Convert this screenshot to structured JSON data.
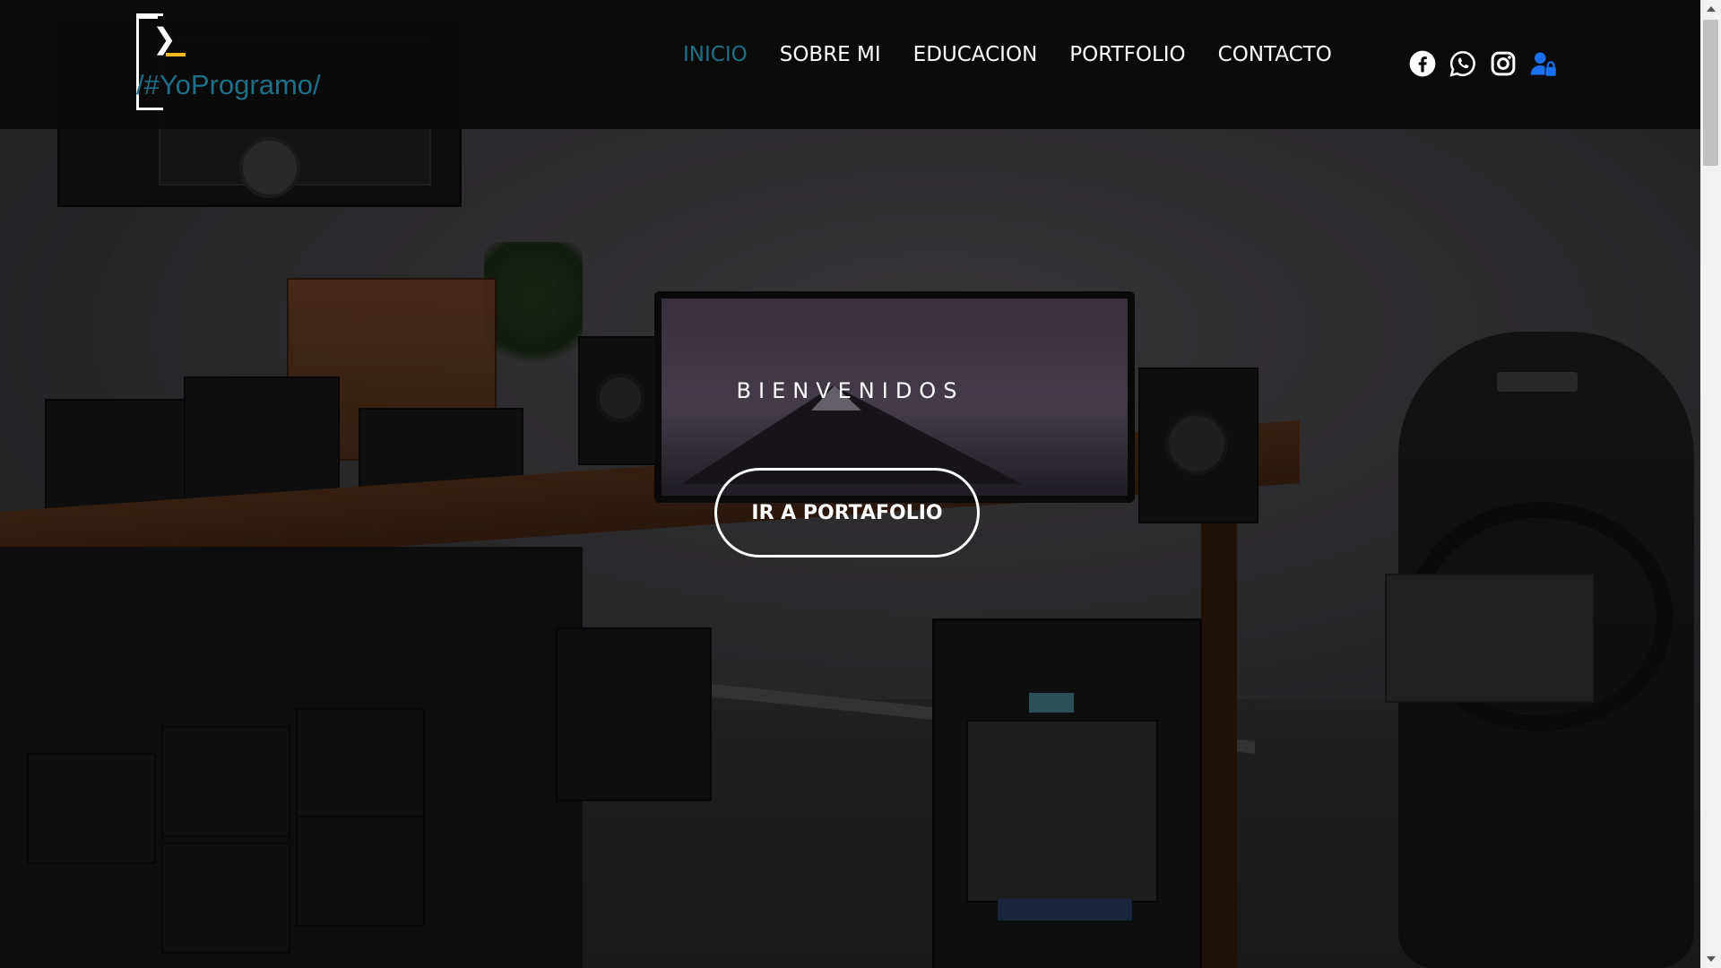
{
  "brand": {
    "text": "/#YoProgramo/",
    "chevron": "❯"
  },
  "nav": {
    "items": [
      {
        "label": "INICIO",
        "active": true
      },
      {
        "label": "SOBRE MI",
        "active": false
      },
      {
        "label": "EDUCACION",
        "active": false
      },
      {
        "label": "PORTFOLIO",
        "active": false
      },
      {
        "label": "CONTACTO",
        "active": false
      }
    ]
  },
  "socials": [
    {
      "icon": "facebook-icon"
    },
    {
      "icon": "whatsapp-icon"
    },
    {
      "icon": "instagram-icon"
    },
    {
      "icon": "user-lock-icon"
    }
  ],
  "hero": {
    "welcome": "BIENVENIDOS",
    "cta_label": "IR A PORTAFOLIO"
  },
  "colors": {
    "accent": "#1f6f87",
    "logo_underscore": "#f5b820",
    "login_icon": "#1d6ff2",
    "header_bg": "#0a0a0a"
  }
}
